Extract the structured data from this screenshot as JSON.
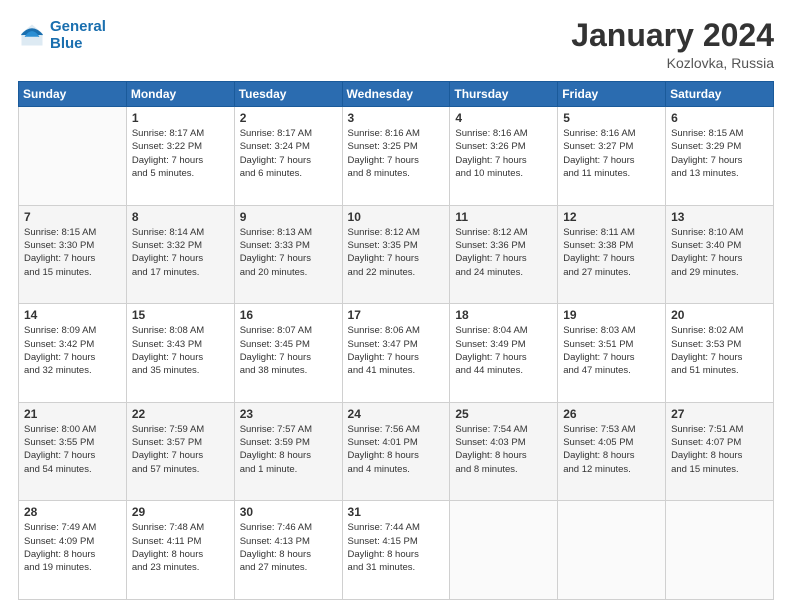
{
  "header": {
    "logo_line1": "General",
    "logo_line2": "Blue",
    "month_year": "January 2024",
    "location": "Kozlovka, Russia"
  },
  "weekdays": [
    "Sunday",
    "Monday",
    "Tuesday",
    "Wednesday",
    "Thursday",
    "Friday",
    "Saturday"
  ],
  "weeks": [
    [
      {
        "day": "",
        "info": ""
      },
      {
        "day": "1",
        "info": "Sunrise: 8:17 AM\nSunset: 3:22 PM\nDaylight: 7 hours\nand 5 minutes."
      },
      {
        "day": "2",
        "info": "Sunrise: 8:17 AM\nSunset: 3:24 PM\nDaylight: 7 hours\nand 6 minutes."
      },
      {
        "day": "3",
        "info": "Sunrise: 8:16 AM\nSunset: 3:25 PM\nDaylight: 7 hours\nand 8 minutes."
      },
      {
        "day": "4",
        "info": "Sunrise: 8:16 AM\nSunset: 3:26 PM\nDaylight: 7 hours\nand 10 minutes."
      },
      {
        "day": "5",
        "info": "Sunrise: 8:16 AM\nSunset: 3:27 PM\nDaylight: 7 hours\nand 11 minutes."
      },
      {
        "day": "6",
        "info": "Sunrise: 8:15 AM\nSunset: 3:29 PM\nDaylight: 7 hours\nand 13 minutes."
      }
    ],
    [
      {
        "day": "7",
        "info": "Sunrise: 8:15 AM\nSunset: 3:30 PM\nDaylight: 7 hours\nand 15 minutes."
      },
      {
        "day": "8",
        "info": "Sunrise: 8:14 AM\nSunset: 3:32 PM\nDaylight: 7 hours\nand 17 minutes."
      },
      {
        "day": "9",
        "info": "Sunrise: 8:13 AM\nSunset: 3:33 PM\nDaylight: 7 hours\nand 20 minutes."
      },
      {
        "day": "10",
        "info": "Sunrise: 8:12 AM\nSunset: 3:35 PM\nDaylight: 7 hours\nand 22 minutes."
      },
      {
        "day": "11",
        "info": "Sunrise: 8:12 AM\nSunset: 3:36 PM\nDaylight: 7 hours\nand 24 minutes."
      },
      {
        "day": "12",
        "info": "Sunrise: 8:11 AM\nSunset: 3:38 PM\nDaylight: 7 hours\nand 27 minutes."
      },
      {
        "day": "13",
        "info": "Sunrise: 8:10 AM\nSunset: 3:40 PM\nDaylight: 7 hours\nand 29 minutes."
      }
    ],
    [
      {
        "day": "14",
        "info": "Sunrise: 8:09 AM\nSunset: 3:42 PM\nDaylight: 7 hours\nand 32 minutes."
      },
      {
        "day": "15",
        "info": "Sunrise: 8:08 AM\nSunset: 3:43 PM\nDaylight: 7 hours\nand 35 minutes."
      },
      {
        "day": "16",
        "info": "Sunrise: 8:07 AM\nSunset: 3:45 PM\nDaylight: 7 hours\nand 38 minutes."
      },
      {
        "day": "17",
        "info": "Sunrise: 8:06 AM\nSunset: 3:47 PM\nDaylight: 7 hours\nand 41 minutes."
      },
      {
        "day": "18",
        "info": "Sunrise: 8:04 AM\nSunset: 3:49 PM\nDaylight: 7 hours\nand 44 minutes."
      },
      {
        "day": "19",
        "info": "Sunrise: 8:03 AM\nSunset: 3:51 PM\nDaylight: 7 hours\nand 47 minutes."
      },
      {
        "day": "20",
        "info": "Sunrise: 8:02 AM\nSunset: 3:53 PM\nDaylight: 7 hours\nand 51 minutes."
      }
    ],
    [
      {
        "day": "21",
        "info": "Sunrise: 8:00 AM\nSunset: 3:55 PM\nDaylight: 7 hours\nand 54 minutes."
      },
      {
        "day": "22",
        "info": "Sunrise: 7:59 AM\nSunset: 3:57 PM\nDaylight: 7 hours\nand 57 minutes."
      },
      {
        "day": "23",
        "info": "Sunrise: 7:57 AM\nSunset: 3:59 PM\nDaylight: 8 hours\nand 1 minute."
      },
      {
        "day": "24",
        "info": "Sunrise: 7:56 AM\nSunset: 4:01 PM\nDaylight: 8 hours\nand 4 minutes."
      },
      {
        "day": "25",
        "info": "Sunrise: 7:54 AM\nSunset: 4:03 PM\nDaylight: 8 hours\nand 8 minutes."
      },
      {
        "day": "26",
        "info": "Sunrise: 7:53 AM\nSunset: 4:05 PM\nDaylight: 8 hours\nand 12 minutes."
      },
      {
        "day": "27",
        "info": "Sunrise: 7:51 AM\nSunset: 4:07 PM\nDaylight: 8 hours\nand 15 minutes."
      }
    ],
    [
      {
        "day": "28",
        "info": "Sunrise: 7:49 AM\nSunset: 4:09 PM\nDaylight: 8 hours\nand 19 minutes."
      },
      {
        "day": "29",
        "info": "Sunrise: 7:48 AM\nSunset: 4:11 PM\nDaylight: 8 hours\nand 23 minutes."
      },
      {
        "day": "30",
        "info": "Sunrise: 7:46 AM\nSunset: 4:13 PM\nDaylight: 8 hours\nand 27 minutes."
      },
      {
        "day": "31",
        "info": "Sunrise: 7:44 AM\nSunset: 4:15 PM\nDaylight: 8 hours\nand 31 minutes."
      },
      {
        "day": "",
        "info": ""
      },
      {
        "day": "",
        "info": ""
      },
      {
        "day": "",
        "info": ""
      }
    ]
  ]
}
